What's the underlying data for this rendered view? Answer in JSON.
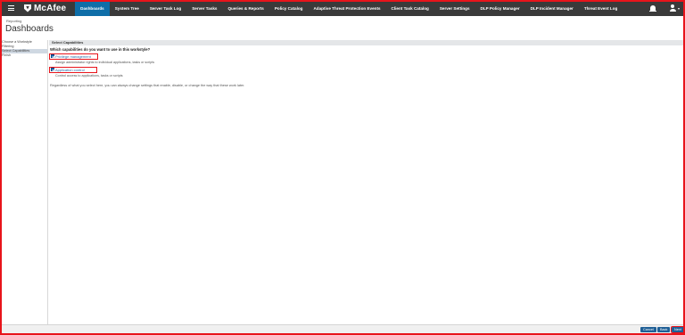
{
  "nav": {
    "brand": "McAfee",
    "items": [
      {
        "label": "Dashboards",
        "active": true
      },
      {
        "label": "System Tree",
        "active": false
      },
      {
        "label": "Server Task Log",
        "active": false
      },
      {
        "label": "Server Tasks",
        "active": false
      },
      {
        "label": "Queries & Reports",
        "active": false
      },
      {
        "label": "Policy Catalog",
        "active": false
      },
      {
        "label": "Adaptive Threat Protection Events",
        "active": false
      },
      {
        "label": "Client Task Catalog",
        "active": false
      },
      {
        "label": "Server Settings",
        "active": false
      },
      {
        "label": "DLP Policy Manager",
        "active": false
      },
      {
        "label": "DLP Incident Manager",
        "active": false
      },
      {
        "label": "Threat Event Log",
        "active": false
      }
    ],
    "icons": [
      "bell-icon",
      "user-icon"
    ]
  },
  "header": {
    "breadcrumb": "Reporting",
    "title": "Dashboards"
  },
  "wizard": {
    "steps": [
      {
        "label": "Choose a Workstyle",
        "selected": false
      },
      {
        "label": "Filtering",
        "selected": false
      },
      {
        "label": "Select Capabilities",
        "selected": true
      },
      {
        "label": "Finish",
        "selected": false
      }
    ]
  },
  "content": {
    "section_header": "Select Capabilities",
    "question": "Which capabilities do you want to use in this workstyle?",
    "options": [
      {
        "label": "Privilege management",
        "checked": true,
        "description": "Assign administrator rights to individual applications, tasks or scripts"
      },
      {
        "label": "Application control",
        "checked": true,
        "description": "Control access to applications, tasks or scripts"
      }
    ],
    "note": "Regardless of what you select here, you can always change settings that enable, disable, or change the way that these work later."
  },
  "footer": {
    "cancel": "Cancel",
    "back": "Back",
    "next": "Next"
  },
  "colors": {
    "nav_bg": "#3a3a3a",
    "active_tab": "#0f6ea8",
    "highlight": "#e8141b",
    "button": "#1f5f96"
  }
}
